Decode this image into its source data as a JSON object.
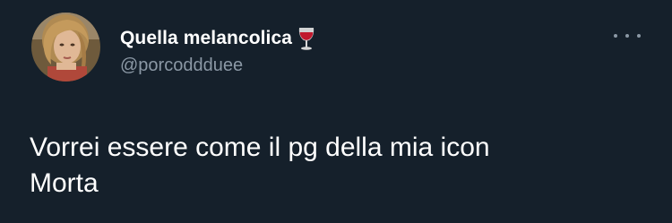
{
  "author": {
    "display_name": "Quella melancolica",
    "handle": "@porcoddduee",
    "name_emoji": "wine-glass-icon"
  },
  "tweet": {
    "lines": [
      "Vorrei essere come il pg della mia icon",
      "Morta"
    ]
  },
  "colors": {
    "background": "#15202b",
    "primary_text": "#ffffff",
    "secondary_text": "#8b98a5"
  }
}
